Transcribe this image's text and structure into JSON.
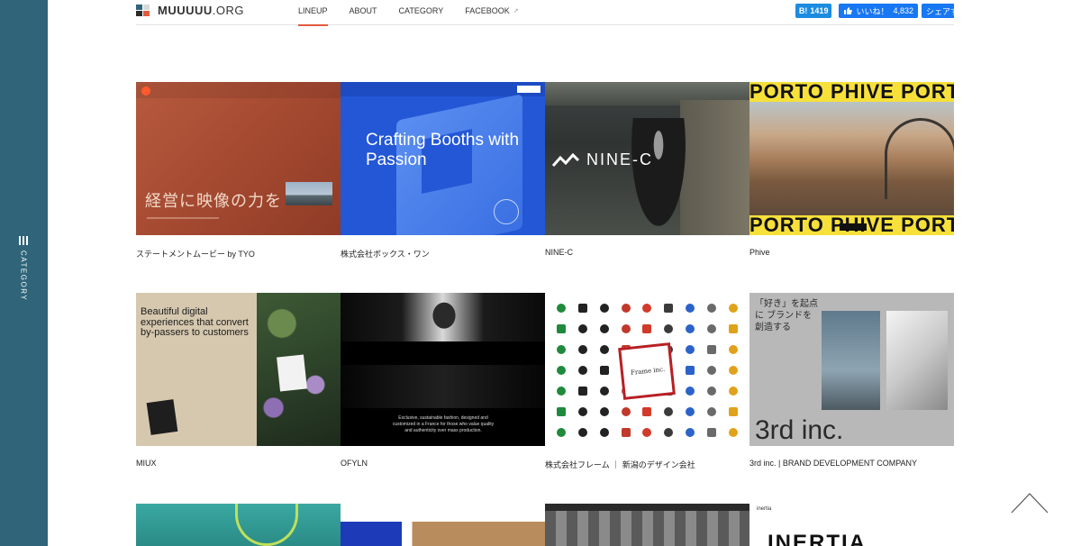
{
  "sidebar": {
    "category_label": "CATEGORY",
    "icon": "menu-bars-icon",
    "color": "#2f6479"
  },
  "header": {
    "logo": {
      "bold": "MUUUUU",
      "rest": ".ORG"
    },
    "nav": [
      {
        "label": "LINEUP",
        "active": true
      },
      {
        "label": "ABOUT"
      },
      {
        "label": "CATEGORY"
      },
      {
        "label": "FACEBOOK",
        "icon": "external-link-icon"
      }
    ],
    "hatena": {
      "mark": "B!",
      "count": "1419"
    },
    "fb_like": {
      "label": "いいね！",
      "count": "4,832"
    },
    "fb_share": {
      "label": "シェアする"
    },
    "accent_color": "#e25b3e"
  },
  "thumbnails": {
    "tyo_title": "経営に映像の力を",
    "boxi_title": "Crafting Booths with Passion",
    "ninec_logo": "NINE-C",
    "phive_band": "PORTO  PHIVE  PORTO",
    "miux_heading": "Beautiful digital experiences that convert by-passers to customers",
    "ofyln_text": "Exclusive, sustainable fashion, designed and customized in a France for those who value quality and authenticity over mass production.",
    "frame_text": "Frame inc.",
    "third_heading": "「好き」を起点に ブランドを創造する",
    "third_big": "3rd inc.",
    "inertia_big": "INERTIA",
    "inertia_label": "inertia"
  },
  "cards": [
    {
      "caption": "ステートメントムービー by TYO"
    },
    {
      "caption": "株式会社ボックス・ワン"
    },
    {
      "caption": "NINE-C"
    },
    {
      "caption": "Phive"
    },
    {
      "caption": "MIUX"
    },
    {
      "caption": "OFYLN"
    },
    {
      "caption": "株式会社フレーム ｜ 新潟のデザイン会社"
    },
    {
      "caption": "3rd inc. | BRAND DEVELOPMENT COMPANY"
    }
  ]
}
